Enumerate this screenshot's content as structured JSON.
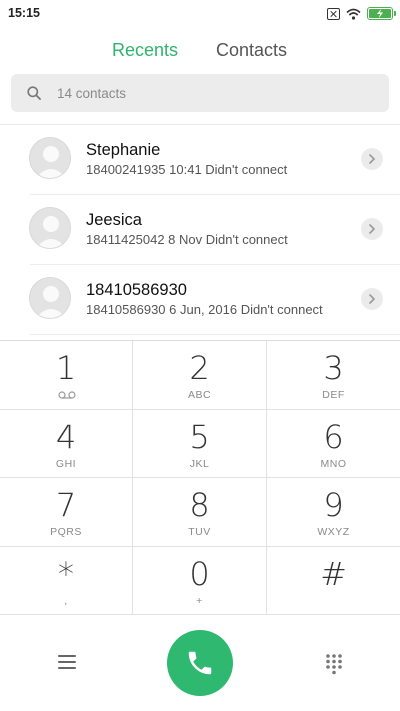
{
  "status_bar": {
    "time": "15:15",
    "icons": [
      "notification-box-icon",
      "wifi-icon",
      "battery-charging-icon"
    ],
    "battery_color": "#4caf50"
  },
  "tabs": [
    {
      "label": "Recents",
      "active": true
    },
    {
      "label": "Contacts",
      "active": false
    }
  ],
  "accent_color": "#2fb36d",
  "search": {
    "placeholder": "14 contacts"
  },
  "recents": [
    {
      "name": "Stephanie",
      "detail": "18400241935  10:41 Didn't connect"
    },
    {
      "name": "Jeesica",
      "detail": "18411425042  8 Nov Didn't connect"
    },
    {
      "name": "18410586930",
      "detail": "18410586930  6 Jun, 2016 Didn't connect"
    }
  ],
  "dialpad": {
    "keys": [
      {
        "digit": "1",
        "sub": ""
      },
      {
        "digit": "2",
        "sub": "ABC"
      },
      {
        "digit": "3",
        "sub": "DEF"
      },
      {
        "digit": "4",
        "sub": "GHI"
      },
      {
        "digit": "5",
        "sub": "JKL"
      },
      {
        "digit": "6",
        "sub": "MNO"
      },
      {
        "digit": "7",
        "sub": "PQRS"
      },
      {
        "digit": "8",
        "sub": "TUV"
      },
      {
        "digit": "9",
        "sub": "WXYZ"
      },
      {
        "digit": "*",
        "sub": ","
      },
      {
        "digit": "0",
        "sub": "+"
      },
      {
        "digit": "#",
        "sub": ""
      }
    ]
  },
  "bottom_bar": {
    "left_icon": "menu-icon",
    "center_icon": "phone-icon",
    "right_icon": "keypad-icon",
    "call_color": "#2fb86f"
  }
}
